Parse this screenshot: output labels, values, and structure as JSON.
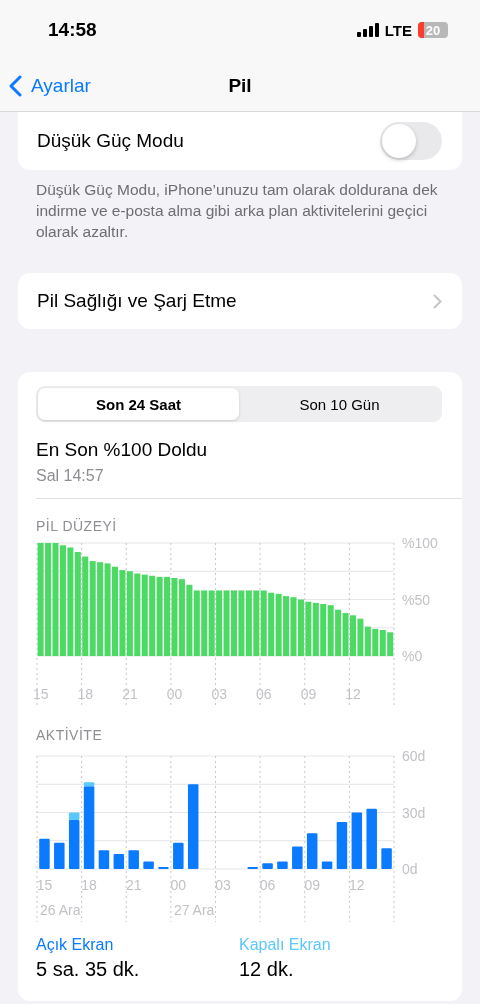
{
  "status_bar": {
    "time": "14:58",
    "network": "LTE",
    "battery": "20"
  },
  "nav": {
    "back": "Ayarlar",
    "title": "Pil"
  },
  "low_power": {
    "label": "Düşük Güç Modu",
    "on": false,
    "footnote": "Düşük Güç Modu, iPhone’unuzu tam olarak doldurana dek indirme ve e-posta alma gibi arka plan aktivitelerini geçici olarak azaltır."
  },
  "health": {
    "label": "Pil Sağlığı ve Şarj Etme"
  },
  "tabs": [
    {
      "label": "Son 24 Saat",
      "selected": true
    },
    {
      "label": "Son 10 Gün",
      "selected": false
    }
  ],
  "last_charge": {
    "title": "En Son %100 Doldu",
    "time": "Sal 14:57"
  },
  "battery_level": {
    "title": "PİL DÜZEYİ",
    "chart_data": {
      "type": "bar",
      "categories": [
        "15",
        null,
        null,
        null,
        null,
        null,
        "18",
        null,
        null,
        null,
        null,
        null,
        "21",
        null,
        null,
        null,
        null,
        null,
        "00",
        null,
        null,
        null,
        null,
        null,
        "03",
        null,
        null,
        null,
        null,
        null,
        "06",
        null,
        null,
        null,
        null,
        null,
        "09",
        null,
        null,
        null,
        null,
        null,
        "12",
        null,
        null,
        null,
        null,
        null
      ],
      "values": [
        100,
        100,
        100,
        98,
        96,
        92,
        88,
        84,
        83,
        82,
        79,
        76,
        75,
        73,
        72,
        71,
        70,
        70,
        69,
        68,
        63,
        58,
        58,
        58,
        58,
        58,
        58,
        58,
        58,
        58,
        58,
        56,
        55,
        53,
        52,
        50,
        48,
        47,
        46,
        45,
        41,
        38,
        36,
        33,
        26,
        24,
        23,
        21
      ],
      "ylim": [
        0,
        100
      ],
      "yticks": [
        {
          "value": 0,
          "label": "%0"
        },
        {
          "value": 50,
          "label": "%50"
        },
        {
          "value": 100,
          "label": "%100"
        }
      ]
    }
  },
  "activity": {
    "title": "AKTİVİTE",
    "dates": [
      "26 Ara",
      "27 Ara"
    ],
    "chart_data": {
      "type": "bar",
      "stacked": true,
      "categories": [
        "15",
        null,
        null,
        "18",
        null,
        null,
        "21",
        null,
        null,
        "00",
        null,
        null,
        "03",
        null,
        null,
        "06",
        null,
        null,
        "09",
        null,
        null,
        "12",
        null,
        null
      ],
      "series": [
        {
          "color": "#0a7aff",
          "values": [
            16,
            14,
            26,
            44,
            10,
            8,
            10,
            4,
            1,
            14,
            45,
            0,
            0,
            0,
            1,
            3,
            4,
            12,
            19,
            4,
            25,
            30,
            32,
            11
          ]
        },
        {
          "color": "#5ac8fa",
          "values": [
            0,
            0,
            4,
            2,
            0,
            0,
            0,
            0,
            0,
            0,
            0,
            0,
            0,
            0,
            0,
            0,
            0,
            0,
            0,
            0,
            0,
            0,
            0,
            0
          ]
        }
      ],
      "ylim": [
        0,
        60
      ],
      "yticks": [
        {
          "value": 0,
          "label": "0d"
        },
        {
          "value": 30,
          "label": "30d"
        },
        {
          "value": 60,
          "label": "60d"
        }
      ]
    }
  },
  "summary": [
    {
      "label": "Açık Ekran",
      "value": "5 sa. 35 dk.",
      "color": "#0a7aff"
    },
    {
      "label": "Kapalı Ekran",
      "value": "12 dk.",
      "color": "#5ac8fa"
    }
  ]
}
